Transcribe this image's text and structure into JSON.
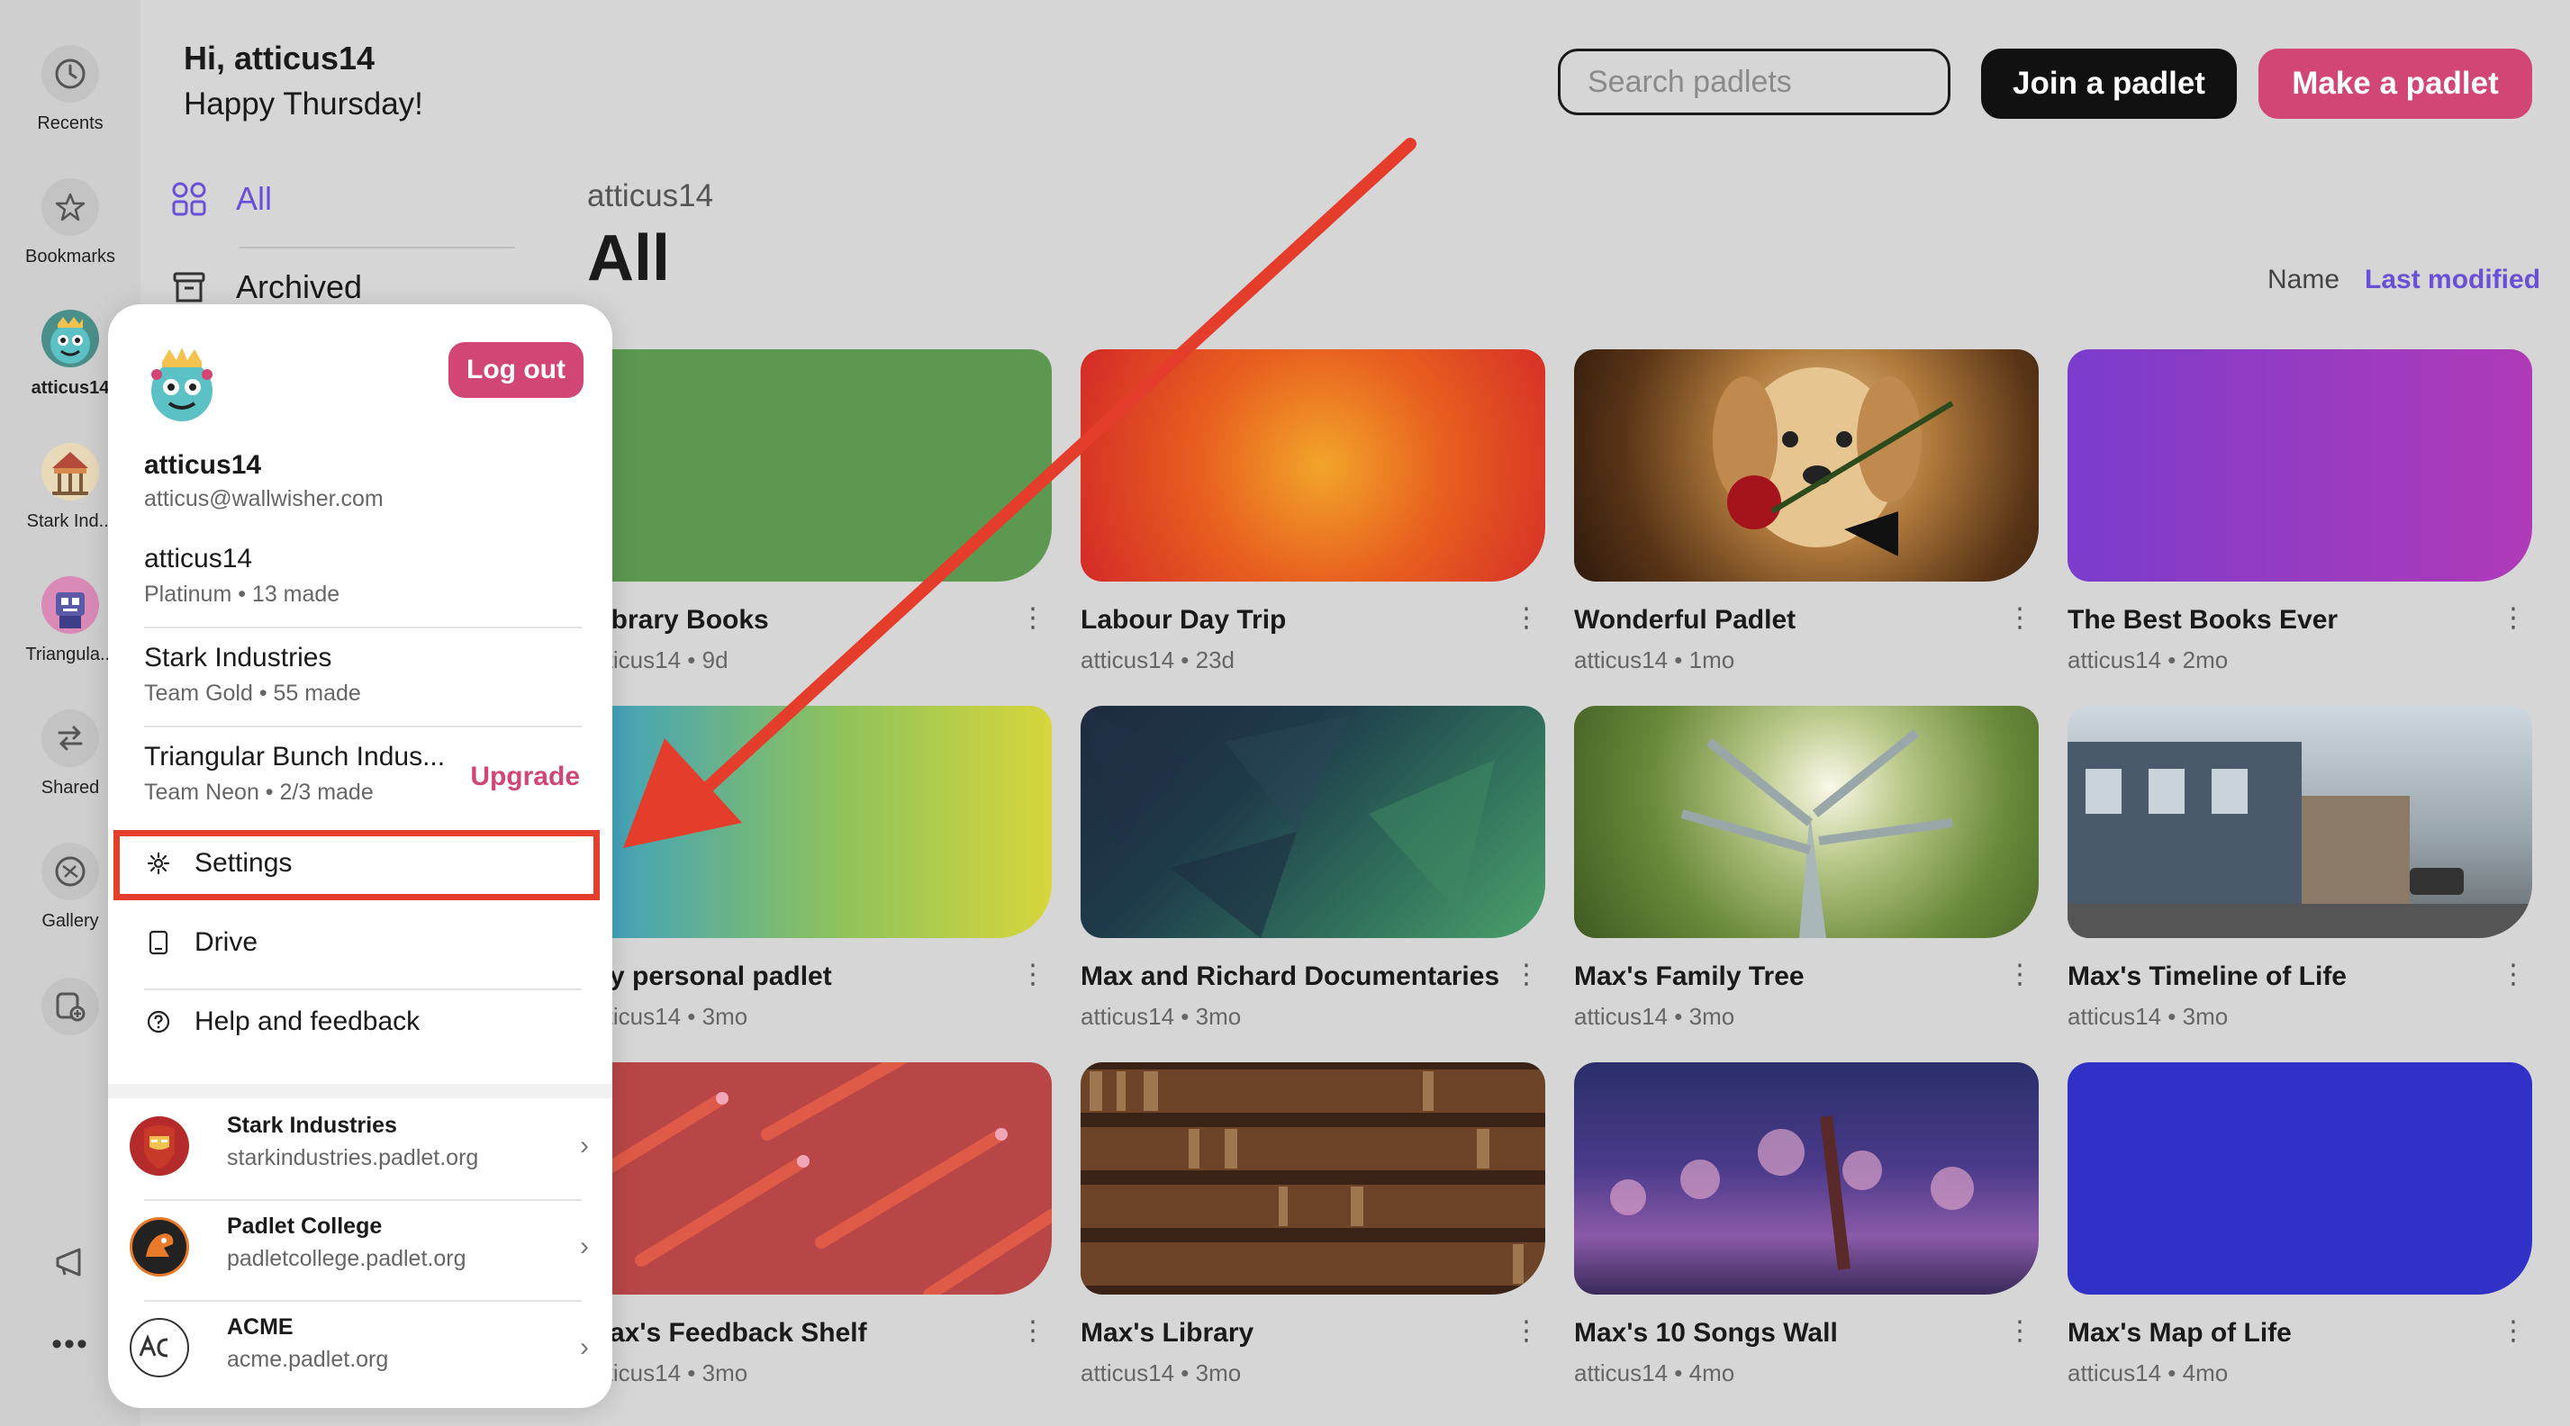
{
  "header": {
    "greeting": "Hi, atticus14",
    "subgreeting": "Happy Thursday!",
    "search_placeholder": "Search padlets",
    "join_label": "Join a padlet",
    "make_label": "Make a padlet"
  },
  "rail": [
    {
      "label": "Recents",
      "icon": "clock-icon"
    },
    {
      "label": "Bookmarks",
      "icon": "star-icon"
    },
    {
      "label": "atticus14",
      "icon": "monster-avatar"
    },
    {
      "label": "Stark Ind...",
      "icon": "carousel-avatar"
    },
    {
      "label": "Triangula...",
      "icon": "robot-avatar"
    },
    {
      "label": "Shared",
      "icon": "shared-icon"
    },
    {
      "label": "Gallery",
      "icon": "gallery-icon"
    }
  ],
  "nav": {
    "all": "All",
    "archived": "Archived"
  },
  "main": {
    "owner": "atticus14",
    "title": "All",
    "sort_name": "Name",
    "sort_last": "Last modified"
  },
  "cards": [
    {
      "title": "Library Books",
      "meta": "atticus14 • 9d"
    },
    {
      "title": "Labour Day Trip",
      "meta": "atticus14 • 23d"
    },
    {
      "title": "Wonderful Padlet",
      "meta": "atticus14 • 1mo"
    },
    {
      "title": "The Best Books Ever",
      "meta": "atticus14 • 2mo"
    },
    {
      "title": "My personal padlet",
      "meta": "atticus14 • 3mo"
    },
    {
      "title": "Max and Richard Documentaries",
      "meta": "atticus14 • 3mo"
    },
    {
      "title": "Max's Family Tree",
      "meta": "atticus14 • 3mo"
    },
    {
      "title": "Max's Timeline of Life",
      "meta": "atticus14 • 3mo"
    },
    {
      "title": "Max's Feedback Shelf",
      "meta": "atticus14 • 3mo"
    },
    {
      "title": "Max's Library",
      "meta": "atticus14 • 3mo"
    },
    {
      "title": "Max's 10 Songs Wall",
      "meta": "atticus14 • 4mo"
    },
    {
      "title": "Max's Map of Life",
      "meta": "atticus14 • 4mo"
    }
  ],
  "popup": {
    "logout": "Log out",
    "username": "atticus14",
    "email": "atticus@wallwisher.com",
    "accounts": [
      {
        "name": "atticus14",
        "meta": "Platinum • 13 made"
      },
      {
        "name": "Stark Industries",
        "meta": "Team Gold • 55 made"
      },
      {
        "name": "Triangular Bunch Indus...",
        "meta": "Team Neon • 2/3 made",
        "upgrade": "Upgrade"
      }
    ],
    "menu": {
      "settings": "Settings",
      "drive": "Drive",
      "help": "Help and feedback"
    },
    "orgs": [
      {
        "name": "Stark Industries",
        "url": "starkindustries.padlet.org"
      },
      {
        "name": "Padlet College",
        "url": "padletcollege.padlet.org"
      },
      {
        "name": "ACME",
        "url": "acme.padlet.org"
      }
    ]
  },
  "colors": {
    "accent_pink": "#d24676",
    "accent_purple": "#6b4fd6",
    "annotation_red": "#e53d2c"
  }
}
